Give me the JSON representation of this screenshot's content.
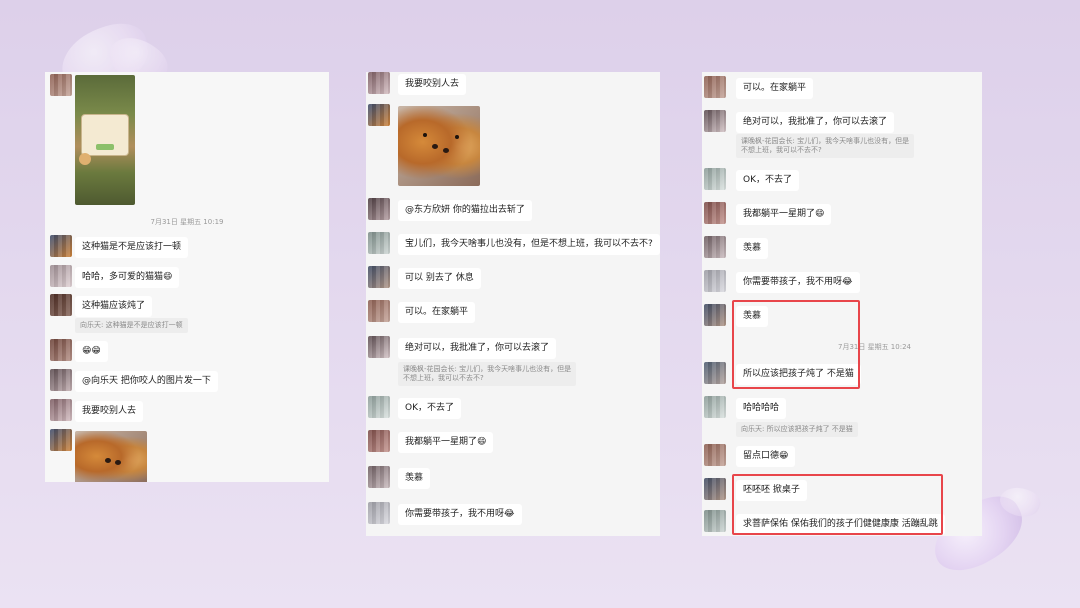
{
  "colors": {
    "highlight": "#e8454a",
    "bubble": "#ffffff",
    "panel_bg": "#f5f5f5",
    "timestamp": "#9a9a9a"
  },
  "panel1": {
    "timestamp": "7月31日 星期五 10:19",
    "messages": [
      "这种猫是不是应该打一顿",
      "哈哈，多可爱的猫猫😄",
      "这种猫应该炖了",
      "😁😁",
      "@向乐天 把你咬人的图片发一下",
      "我要咬别人去"
    ],
    "quote": "向乐天: 这种猫是不是应该打一顿"
  },
  "panel2": {
    "messages": [
      "我要咬别人去",
      "@东方欣妍 你的猫拉出去斩了",
      "宝儿们，我今天啥事儿也没有，但是不想上班，我可以不去不?",
      "可以  别去了  休息",
      "可以。在家躺平",
      "绝对可以，我批准了，你可以去滚了",
      "OK，不去了",
      "我都躺平一星期了😄",
      "羡慕",
      "你需要带孩子，我不用呀😂"
    ],
    "quote": [
      "课晚枫-花园会长: 宝儿们，我今天啥事儿也没有，但是",
      "不想上班，我可以不去不?"
    ]
  },
  "panel3": {
    "messages": [
      "可以。在家躺平",
      "绝对可以，我批准了，你可以去滚了",
      "OK，不去了",
      "我都躺平一星期了😄",
      "羡慕",
      "你需要带孩子，我不用呀😂",
      "羡慕",
      "所以应该把孩子炖了  不是猫",
      "哈哈哈哈",
      "留点口德😁",
      "呸呸呸  掀桌子",
      "求菩萨保佑  保佑我们的孩子们健健康康  活蹦乱跳"
    ],
    "quote1": [
      "课晚枫-花园会长: 宝儿们，我今天啥事儿也没有，但是",
      "不想上班，我可以不去不?"
    ],
    "timestamp": "7月31日 星期五 10:24",
    "quote2": "向乐天: 所以应该把孩子炖了  不是猫"
  }
}
